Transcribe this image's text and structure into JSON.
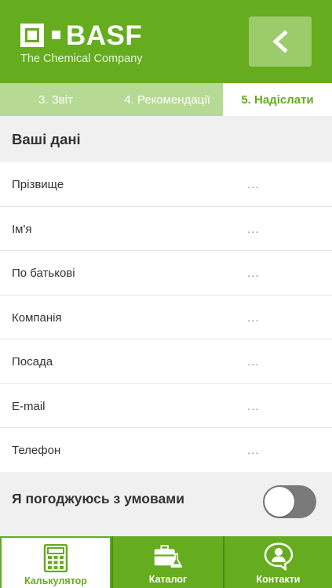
{
  "header": {
    "brand": "BASF",
    "tagline": "The Chemical Company",
    "back_icon": "chevron-left-icon"
  },
  "steps": [
    {
      "label": "3. Звіт",
      "active": false
    },
    {
      "label": "4. Рекомендації",
      "active": false
    },
    {
      "label": "5. Надіслати",
      "active": true
    }
  ],
  "section": {
    "title": "Ваші дані"
  },
  "fields": [
    {
      "label": "Прізвище",
      "value": "..."
    },
    {
      "label": "Ім'я",
      "value": "..."
    },
    {
      "label": "По батькові",
      "value": "..."
    },
    {
      "label": "Компанія",
      "value": "..."
    },
    {
      "label": "Посада",
      "value": "..."
    },
    {
      "label": "E-mail",
      "value": "..."
    },
    {
      "label": "Телефон",
      "value": "..."
    }
  ],
  "agreement": {
    "label": "Я погоджуюсь з умовами",
    "checked": false
  },
  "tabs": [
    {
      "label": "Калькулятор",
      "icon": "calculator-icon",
      "active": true
    },
    {
      "label": "Каталог",
      "icon": "briefcase-flask-icon",
      "active": false
    },
    {
      "label": "Контакти",
      "icon": "contact-person-icon",
      "active": false
    }
  ],
  "colors": {
    "brand_green": "#65ac1e",
    "light_green": "#b6d994",
    "toggle_off": "#7a7a7a"
  }
}
